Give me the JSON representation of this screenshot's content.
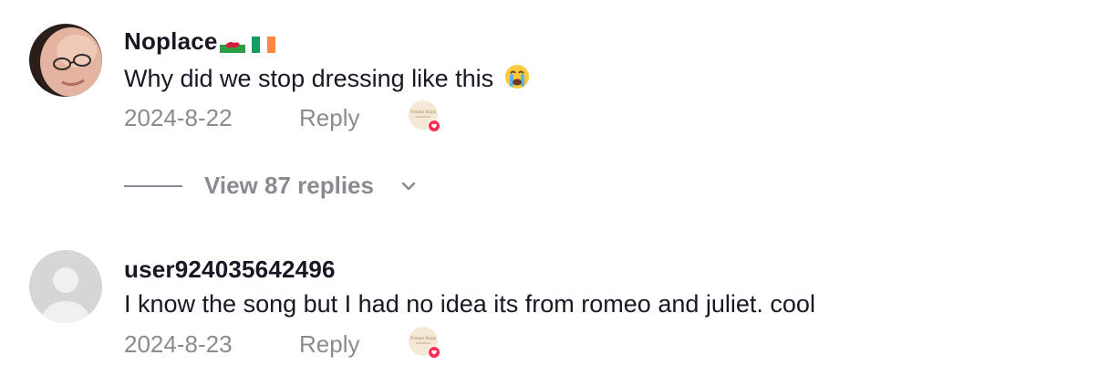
{
  "comments": [
    {
      "username": "Noplace",
      "flags": [
        "flag-wales-icon",
        "flag-ireland-icon"
      ],
      "text": "Why did we stop dressing like this",
      "emoji": "😭",
      "date": "2024-8-22",
      "reply_label": "Reply",
      "liker_caption": "Tempus Regia"
    },
    {
      "username": "user924035642496",
      "text": "I know the song but I had no idea its from romeo and juliet. cool",
      "date": "2024-8-23",
      "reply_label": "Reply",
      "liker_caption": "Tempus Regia"
    }
  ],
  "view_replies": {
    "label": "View 87 replies"
  },
  "colors": {
    "text": "#161823",
    "muted": "#8a8b91",
    "heart": "#fe2c55"
  }
}
